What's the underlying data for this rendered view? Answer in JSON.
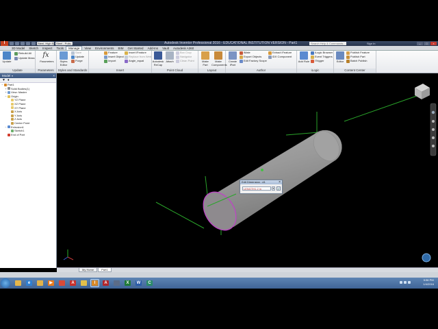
{
  "app": {
    "title": "Autodesk Inventor Professional 2016 - EDUCATIONAL INSTITUTION VERSION - Part1",
    "logo": "I",
    "quick_access_material": "Steel, High Str...",
    "quick_access_appearance": "Steel - Polis...",
    "search_placeholder": "Search Help & Commands...",
    "sign_in": "Sign In",
    "window_buttons": [
      "–",
      "□",
      "×"
    ]
  },
  "ribbon_tabs": [
    "3D Model",
    "Sketch",
    "Inspect",
    "Tools",
    "Manage",
    "View",
    "Environments",
    "BIM",
    "Get Started",
    "Add-Ins",
    "Vault",
    "Autodesk A360"
  ],
  "active_tab": "Manage",
  "ribbon": {
    "update": {
      "big": "Update",
      "items": [
        "Rebuild All",
        "Update Mass"
      ],
      "label": "Update"
    },
    "parameters": {
      "big": "Parameters",
      "label": "Parameters"
    },
    "styles": {
      "big": "Styles Editor",
      "items": [
        "Save",
        "Update",
        "Purge"
      ],
      "label": "Styles and Standards"
    },
    "insert": {
      "items": [
        "Feature",
        "Insert Object",
        "Import",
        "Insert iFeature",
        "Replace from Web",
        "Angle_equal"
      ],
      "label": "Insert"
    },
    "point_cloud": {
      "big": [
        "Autodesk ReCap",
        "Attach"
      ],
      "items": [
        "Box Crop",
        "Navigator",
        "Clean Point"
      ],
      "label": "Point Cloud"
    },
    "layout": {
      "big": [
        "Make Part",
        "Make Components"
      ],
      "label": "Layout"
    },
    "author": {
      "big": "Create iPart",
      "items": [
        "iMate",
        "Export Objects",
        "Edit Factory Scope",
        "Extract iFeature",
        "iDX Component"
      ],
      "label": "Author"
    },
    "ilogic": {
      "big": "Add Rule",
      "items": [
        "iLogic Browser",
        "Event Triggers",
        "iTrigger"
      ],
      "label": "iLogic"
    },
    "content_center": {
      "big": "Editor",
      "items": [
        "Publish Feature",
        "Publish Part",
        "Batch Publish"
      ],
      "label": "Content Center"
    }
  },
  "browser": {
    "title": "Model",
    "close": "×",
    "tools": [
      "▼",
      "♦"
    ],
    "tree": [
      {
        "label": "Part1",
        "level": 0,
        "expander": "−",
        "icon": "part-icon",
        "color": "#d88a2a"
      },
      {
        "label": "Solid Bodies(1)",
        "level": 1,
        "expander": "+",
        "icon": "solid-bodies-icon",
        "color": "#8c8c8c"
      },
      {
        "label": "View: Master",
        "level": 1,
        "expander": "+",
        "icon": "view-icon",
        "color": "#6f9bd1"
      },
      {
        "label": "Origin",
        "level": 1,
        "expander": "−",
        "icon": "folder-icon",
        "color": "#e2c25a"
      },
      {
        "label": "YZ Plane",
        "level": 2,
        "expander": "",
        "icon": "plane-icon",
        "color": "#e7c96b"
      },
      {
        "label": "XZ Plane",
        "level": 2,
        "expander": "",
        "icon": "plane-icon",
        "color": "#e7c96b"
      },
      {
        "label": "XY Plane",
        "level": 2,
        "expander": "",
        "icon": "plane-icon",
        "color": "#e7c96b"
      },
      {
        "label": "X Axis",
        "level": 2,
        "expander": "",
        "icon": "axis-icon",
        "color": "#c9a04a"
      },
      {
        "label": "Y Axis",
        "level": 2,
        "expander": "",
        "icon": "axis-icon",
        "color": "#c9a04a"
      },
      {
        "label": "Z Axis",
        "level": 2,
        "expander": "",
        "icon": "axis-icon",
        "color": "#c9a04a"
      },
      {
        "label": "Center Point",
        "level": 2,
        "expander": "",
        "icon": "point-icon",
        "color": "#c9a04a"
      },
      {
        "label": "Extrusion1",
        "level": 1,
        "expander": "−",
        "icon": "extrude-icon",
        "color": "#5a8ad0"
      },
      {
        "label": "Sketch1",
        "level": 2,
        "expander": "",
        "icon": "sketch-icon",
        "color": "#6cb06c"
      },
      {
        "label": "End of Part",
        "level": 1,
        "expander": "",
        "icon": "end-of-part-icon",
        "color": "#d23c2c"
      }
    ]
  },
  "doc_tabs": [
    "My Home",
    "Part1"
  ],
  "active_doc": "Part1",
  "dialog": {
    "title": "Edit Dimension : d1",
    "value": "LENGTH1 2 in",
    "ok": "✓",
    "dropdown": "▼",
    "close": "×"
  },
  "viewcube": {
    "label": ""
  },
  "taskbar": {
    "apps": [
      {
        "name": "windows-explorer-app",
        "color": "#e6b64a",
        "glyph": ""
      },
      {
        "name": "internet-explorer-app",
        "color": "#2f7fd1",
        "glyph": "e"
      },
      {
        "name": "file-explorer-app",
        "color": "#e2b24a",
        "glyph": ""
      },
      {
        "name": "media-player-app",
        "color": "#e87a1e",
        "glyph": "▶"
      },
      {
        "name": "chrome-app",
        "color": "#d84a38",
        "glyph": ""
      },
      {
        "name": "autodesk-app",
        "color": "#c9302c",
        "glyph": "A"
      },
      {
        "name": "paint-app",
        "color": "#e3c04a",
        "glyph": ""
      },
      {
        "name": "inventor-app",
        "color": "#d88a2a",
        "glyph": "I"
      },
      {
        "name": "acrobat-app",
        "color": "#b1262a",
        "glyph": "A"
      },
      {
        "name": "snagit-app",
        "color": "#5b6c88",
        "glyph": ""
      },
      {
        "name": "excel-app",
        "color": "#1f7a3a",
        "glyph": "X"
      },
      {
        "name": "word-app",
        "color": "#2a5ca8",
        "glyph": "W"
      },
      {
        "name": "camtasia-app",
        "color": "#2a8a6a",
        "glyph": "C"
      }
    ],
    "time": "5:56 PM",
    "date": "1/4/2016"
  }
}
